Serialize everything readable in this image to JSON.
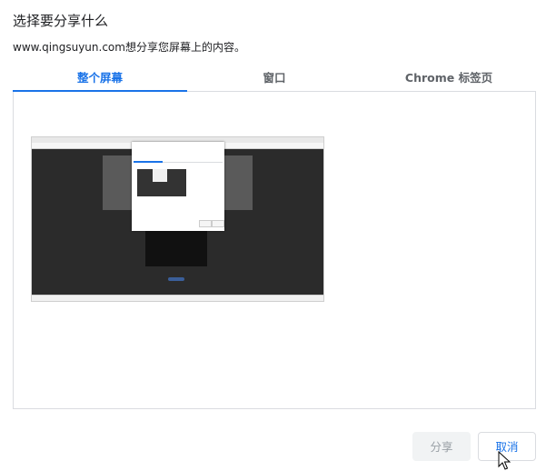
{
  "dialog": {
    "title": "选择要分享什么",
    "subtitle": "www.qingsuyun.com想分享您屏幕上的内容。"
  },
  "tabs": [
    {
      "label": "整个屏幕",
      "active": true
    },
    {
      "label": "窗口",
      "active": false
    },
    {
      "label": "Chrome 标签页",
      "active": false
    }
  ],
  "buttons": {
    "share_label": "分享",
    "cancel_label": "取消"
  },
  "colors": {
    "accent": "#1a73e8",
    "disabled_bg": "#f1f3f4",
    "disabled_text": "#9aa0a6"
  }
}
